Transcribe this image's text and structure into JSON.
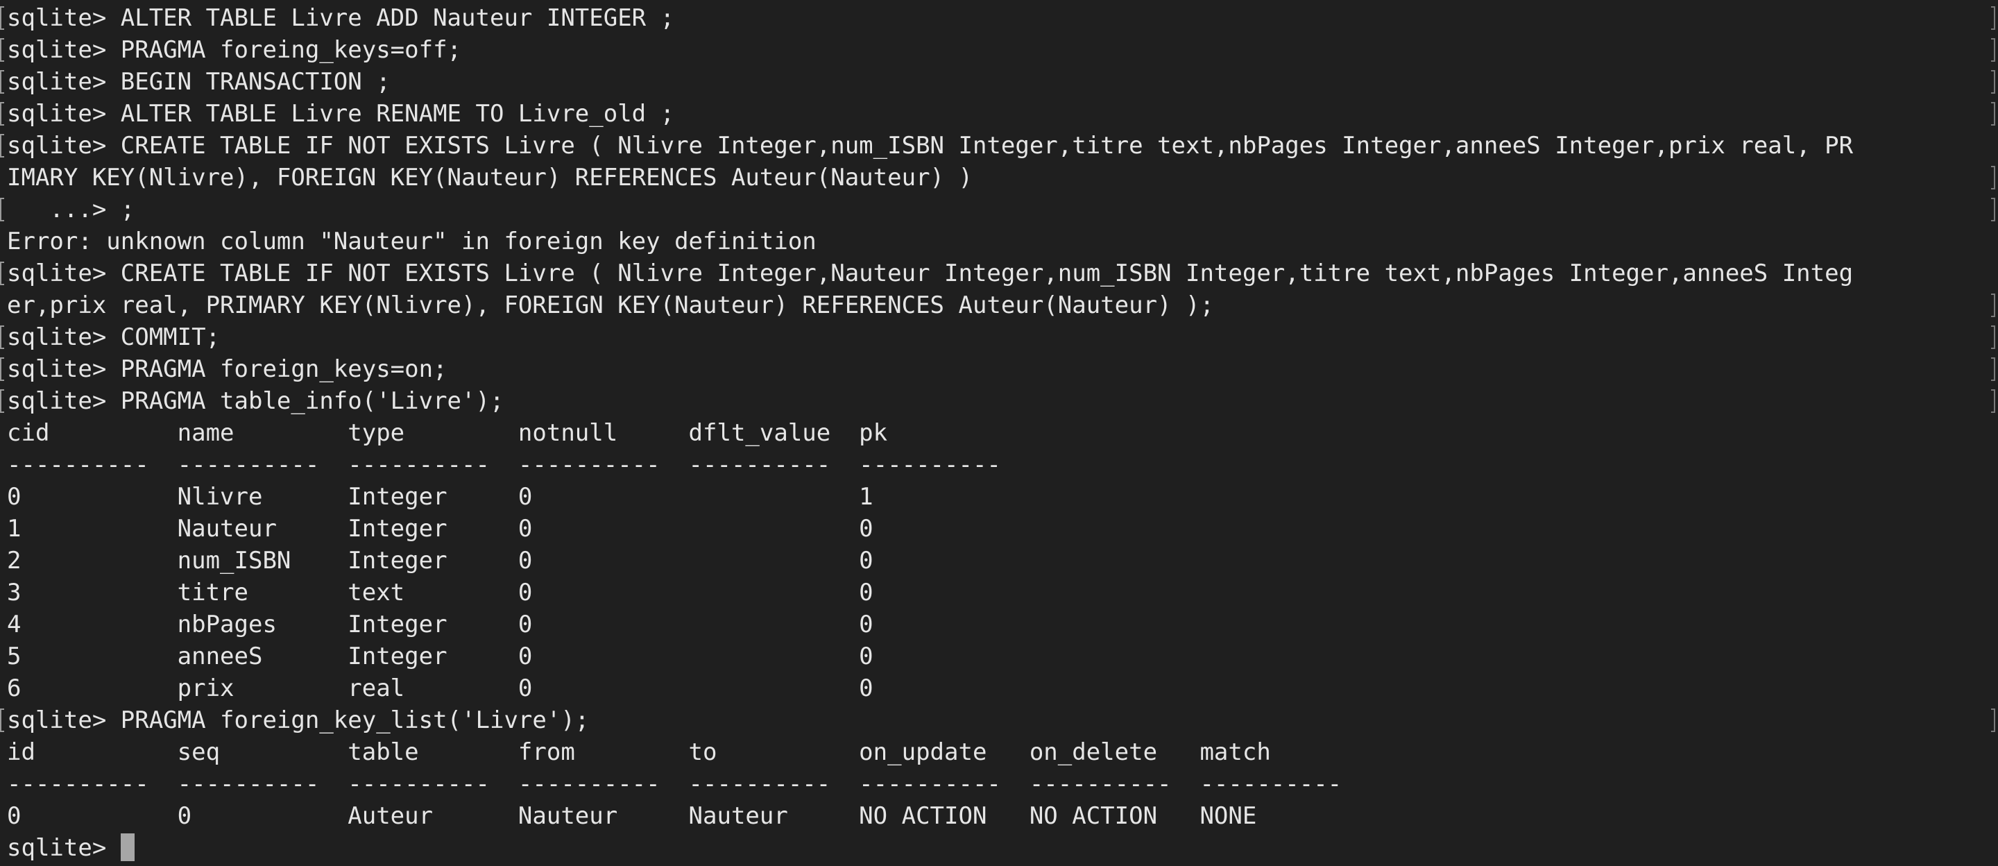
{
  "terminal": {
    "lines": [
      "sqlite> ALTER TABLE Livre ADD Nauteur INTEGER ;",
      "sqlite> PRAGMA foreing_keys=off;",
      "sqlite> BEGIN TRANSACTION ;",
      "sqlite> ALTER TABLE Livre RENAME TO Livre_old ;",
      "sqlite> CREATE TABLE IF NOT EXISTS Livre ( Nlivre Integer,num_ISBN Integer,titre text,nbPages Integer,anneeS Integer,prix real, PR",
      "IMARY KEY(Nlivre), FOREIGN KEY(Nauteur) REFERENCES Auteur(Nauteur) )",
      "   ...> ;",
      "Error: unknown column \"Nauteur\" in foreign key definition",
      "sqlite> CREATE TABLE IF NOT EXISTS Livre ( Nlivre Integer,Nauteur Integer,num_ISBN Integer,titre text,nbPages Integer,anneeS Integ",
      "er,prix real, PRIMARY KEY(Nlivre), FOREIGN KEY(Nauteur) REFERENCES Auteur(Nauteur) );",
      "sqlite> COMMIT;",
      "sqlite> PRAGMA foreign_keys=on;",
      "sqlite> PRAGMA table_info('Livre');",
      "cid         name        type        notnull     dflt_value  pk",
      "----------  ----------  ----------  ----------  ----------  ----------",
      "0           Nlivre      Integer     0                       1",
      "1           Nauteur     Integer     0                       0",
      "2           num_ISBN    Integer     0                       0",
      "3           titre       text        0                       0",
      "4           nbPages     Integer     0                       0",
      "5           anneeS      Integer     0                       0",
      "6           prix        real        0                       0",
      "sqlite> PRAGMA foreign_key_list('Livre');",
      "id          seq         table       from        to          on_update   on_delete   match",
      "----------  ----------  ----------  ----------  ----------  ----------  ----------  ----------",
      "0           0           Auteur      Nauteur     Nauteur     NO ACTION   NO ACTION   NONE"
    ],
    "prompt": "sqlite> "
  }
}
